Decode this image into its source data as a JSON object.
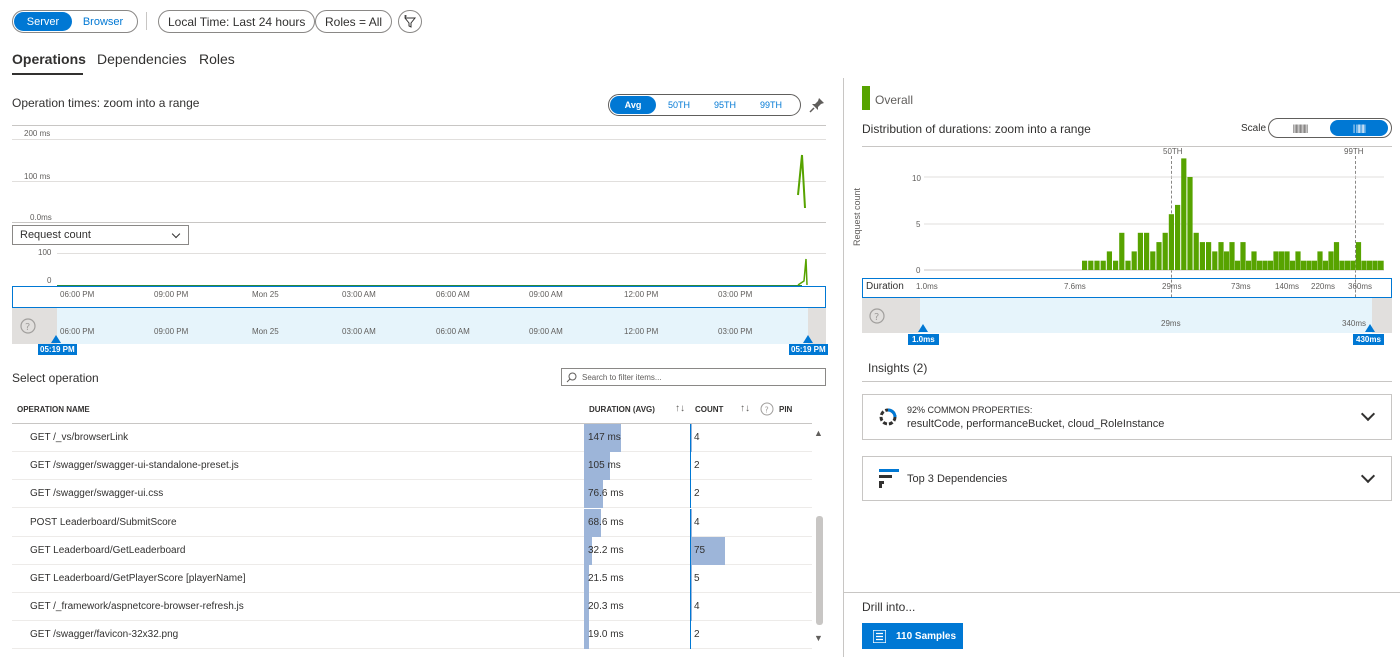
{
  "filters": {
    "server_label": "Server",
    "browser_label": "Browser",
    "time_label": "Local Time: Last 24 hours",
    "roles_label": "Roles = All"
  },
  "tabs": [
    "Operations",
    "Dependencies",
    "Roles"
  ],
  "left_chart": {
    "title": "Operation times: zoom into a range",
    "percentiles": [
      "Avg",
      "50TH",
      "95TH",
      "99TH"
    ],
    "y_labels": [
      "200 ms",
      "100 ms",
      "0.0ms"
    ],
    "metric_select": "Request count",
    "count_labels": [
      "100",
      "0"
    ],
    "time_ticks": [
      "06:00 PM",
      "09:00 PM",
      "Mon 25",
      "03:00 AM",
      "06:00 AM",
      "09:00 AM",
      "12:00 PM",
      "03:00 PM"
    ],
    "range_start": "05:19 PM",
    "range_end": "05:19 PM"
  },
  "operations": {
    "title": "Select operation",
    "search_placeholder": "Search to filter items...",
    "headers": {
      "name": "OPERATION NAME",
      "duration": "DURATION (AVG)",
      "count": "COUNT",
      "pin": "PIN"
    },
    "rows": [
      {
        "name": "GET /_vs/browserLink",
        "duration": "147 ms",
        "duration_ms": 147,
        "count": "4",
        "count_value": 4
      },
      {
        "name": "GET /swagger/swagger-ui-standalone-preset.js",
        "duration": "105 ms",
        "duration_ms": 105,
        "count": "2",
        "count_value": 2
      },
      {
        "name": "GET /swagger/swagger-ui.css",
        "duration": "76.6 ms",
        "duration_ms": 76.6,
        "count": "2",
        "count_value": 2
      },
      {
        "name": "POST Leaderboard/SubmitScore",
        "duration": "68.6 ms",
        "duration_ms": 68.6,
        "count": "4",
        "count_value": 4
      },
      {
        "name": "GET Leaderboard/GetLeaderboard",
        "duration": "32.2 ms",
        "duration_ms": 32.2,
        "count": "75",
        "count_value": 75
      },
      {
        "name": "GET Leaderboard/GetPlayerScore [playerName]",
        "duration": "21.5 ms",
        "duration_ms": 21.5,
        "count": "5",
        "count_value": 5
      },
      {
        "name": "GET /_framework/aspnetcore-browser-refresh.js",
        "duration": "20.3 ms",
        "duration_ms": 20.3,
        "count": "4",
        "count_value": 4
      },
      {
        "name": "GET /swagger/favicon-32x32.png",
        "duration": "19.0 ms",
        "duration_ms": 19.0,
        "count": "2",
        "count_value": 2
      }
    ]
  },
  "right_panel": {
    "legend": "Overall",
    "title": "Distribution of durations: zoom into a range",
    "scale_label": "Scale",
    "y_axis_label": "Request count",
    "y_ticks": [
      "10",
      "5",
      "0"
    ],
    "percentile_markers": [
      "50TH",
      "99TH"
    ],
    "x_label": "Duration",
    "x_ticks": [
      "1.0ms",
      "7.6ms",
      "29ms",
      "73ms",
      "140ms",
      "220ms",
      "360ms"
    ],
    "lower_ticks": [
      "29ms",
      "340ms"
    ],
    "range_start": "1.0ms",
    "range_end": "430ms",
    "insights_title": "Insights (2)",
    "insight1_caption": "92% COMMON PROPERTIES:",
    "insight1_text": "resultCode, performanceBucket, cloud_RoleInstance",
    "insight2_text": "Top 3 Dependencies",
    "drill_label": "Drill into...",
    "samples_button": "110 Samples",
    "histogram_counts": [
      1,
      1,
      1,
      1,
      2,
      1,
      4,
      1,
      2,
      4,
      4,
      2,
      3,
      4,
      6,
      7,
      12,
      10,
      4,
      3,
      3,
      2,
      3,
      2,
      3,
      1,
      3,
      1,
      2,
      1,
      1,
      1,
      2,
      2,
      2,
      1,
      2,
      1,
      1,
      1,
      2,
      1,
      2,
      3,
      1,
      1,
      1,
      3,
      1,
      1,
      1,
      1,
      1
    ]
  },
  "colors": {
    "accent": "#0078d4",
    "green": "#57a300",
    "bar": "#9db5d9"
  }
}
